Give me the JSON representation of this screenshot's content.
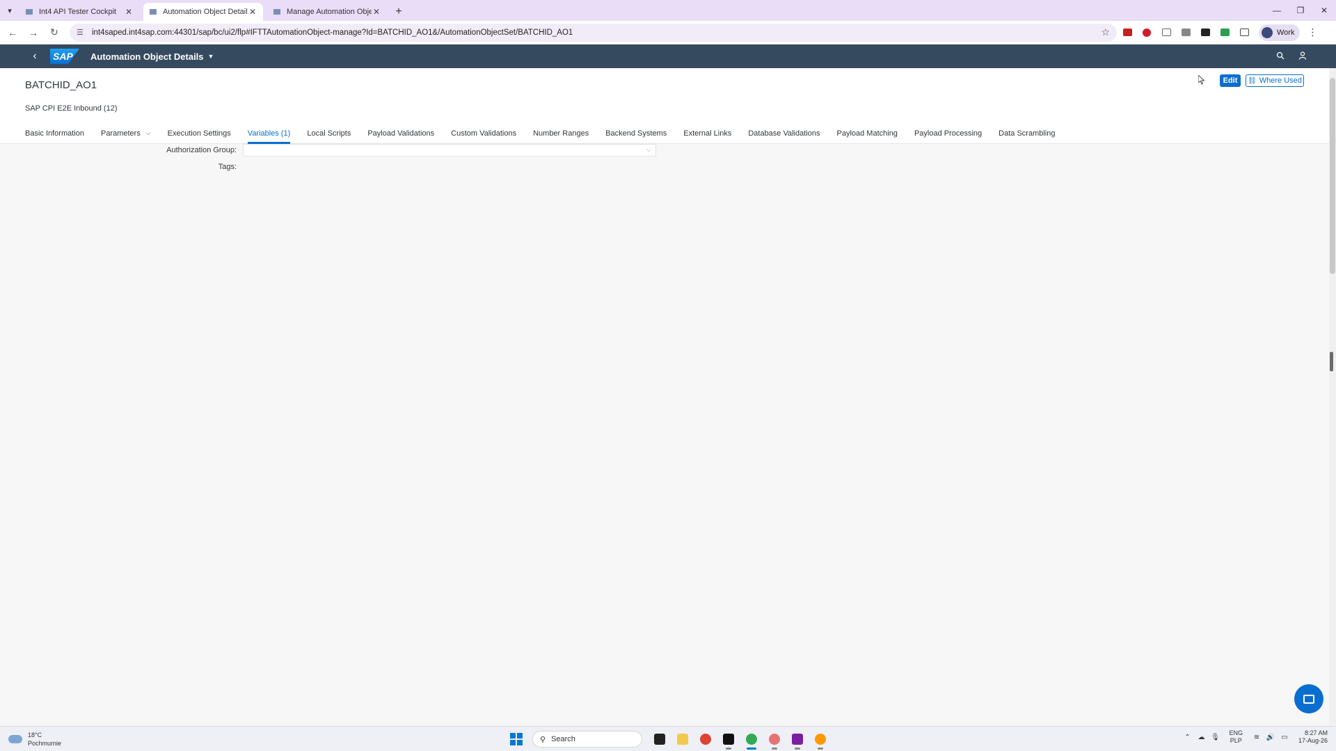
{
  "browser": {
    "tabs": [
      {
        "title": "Int4 API Tester Cockpit",
        "active": false
      },
      {
        "title": "Automation Object Details",
        "active": true
      },
      {
        "title": "Manage Automation Objects",
        "active": false
      }
    ],
    "url": "int4saped.int4sap.com:44301/sap/bc/ui2/flp#IFTTAutomationObject-manage?Id=BATCHID_AO1&/AutomationObjectSet/BATCHID_AO1",
    "profile_label": "Work"
  },
  "shell": {
    "logo_text": "SAP",
    "app_title": "Automation Object Details"
  },
  "object": {
    "title": "BATCHID_AO1",
    "subtitle": "SAP CPI E2E Inbound (12)",
    "edit_label": "Edit",
    "where_used_label": "Where Used"
  },
  "tabs": [
    {
      "label": "Basic Information"
    },
    {
      "label": "Parameters",
      "dropdown": true
    },
    {
      "label": "Execution Settings"
    },
    {
      "label": "Variables (1)",
      "selected": true
    },
    {
      "label": "Local Scripts"
    },
    {
      "label": "Payload Validations"
    },
    {
      "label": "Custom Validations"
    },
    {
      "label": "Number Ranges"
    },
    {
      "label": "Backend Systems"
    },
    {
      "label": "External Links"
    },
    {
      "label": "Database Validations"
    },
    {
      "label": "Payload Matching"
    },
    {
      "label": "Payload Processing"
    },
    {
      "label": "Data Scrambling"
    }
  ],
  "form": {
    "authorization_group_label": "Authorization Group:",
    "authorization_group_value": "",
    "tags_label": "Tags:"
  },
  "taskbar": {
    "temperature": "18°C",
    "location": "Pochmurnie",
    "search_placeholder": "Search",
    "lang_top": "ENG",
    "lang_bottom": "PLP",
    "time": "8:27 AM",
    "date": "17-Aug-26"
  },
  "colors": {
    "shell_bg": "#354a5f",
    "accent": "#0a6ed1",
    "tabstrip_bg": "#e9ddf7"
  }
}
